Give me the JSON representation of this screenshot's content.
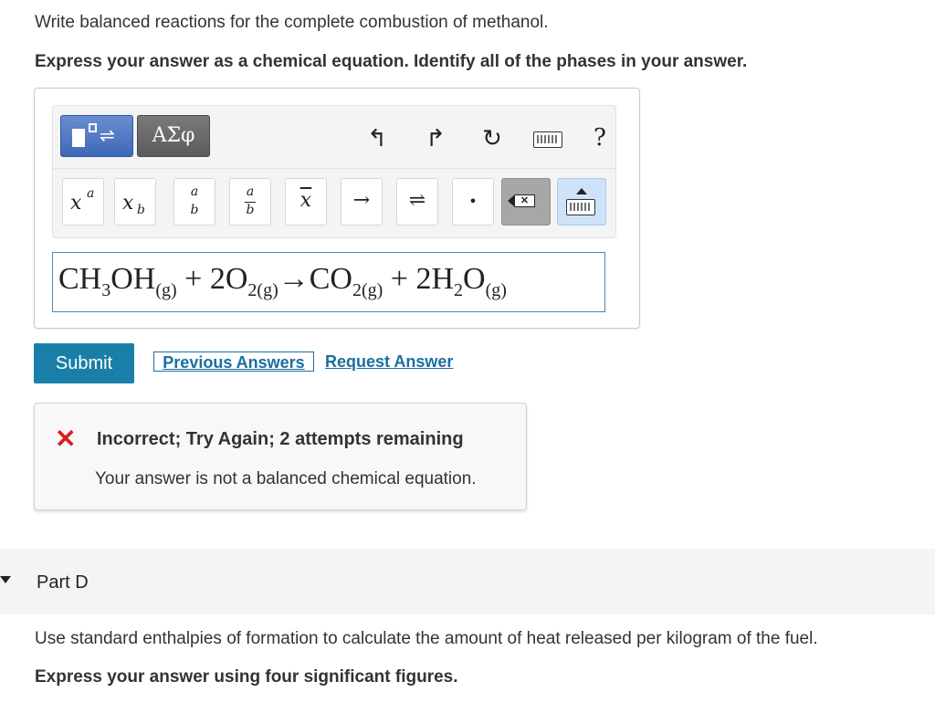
{
  "question": {
    "text": "Write balanced reactions for the complete combustion of methanol.",
    "instruction": "Express your answer as a chemical equation. Identify all of the phases in your answer."
  },
  "toolbar": {
    "greek_label": "ΑΣφ",
    "undo_icon": "↰",
    "redo_icon": "↱",
    "reset_icon": "↻",
    "help_label": "?",
    "symbols": {
      "superscript_main": "x",
      "superscript_sup": "a",
      "subscript_main": "x",
      "subscript_sub": "b",
      "fraction_num": "a",
      "fraction_den": "b",
      "stacked_num": "a",
      "stacked_den": "b",
      "times": "x",
      "arrow": "→",
      "equilibrium": "⇌",
      "dot": "•",
      "backspace": "✕"
    }
  },
  "answer": {
    "p1": "CH",
    "s1": "3",
    "p2": "OH",
    "s2": "(g)",
    "p3": " + 2O",
    "s3": "2(g)",
    "p4": "→CO",
    "s4": "2(g)",
    "p5": " + 2H",
    "s5": "2",
    "p6": "O",
    "s6": "(g)"
  },
  "actions": {
    "submit": "Submit",
    "previous": "Previous Answers",
    "request": "Request Answer"
  },
  "feedback": {
    "icon": "✕",
    "title": "Incorrect; Try Again; 2 attempts remaining",
    "message": "Your answer is not a balanced chemical equation."
  },
  "part_d": {
    "title": "Part D",
    "text": "Use standard enthalpies of formation to calculate the amount of heat released per kilogram of the fuel.",
    "instruction": "Express your answer using four significant figures."
  }
}
